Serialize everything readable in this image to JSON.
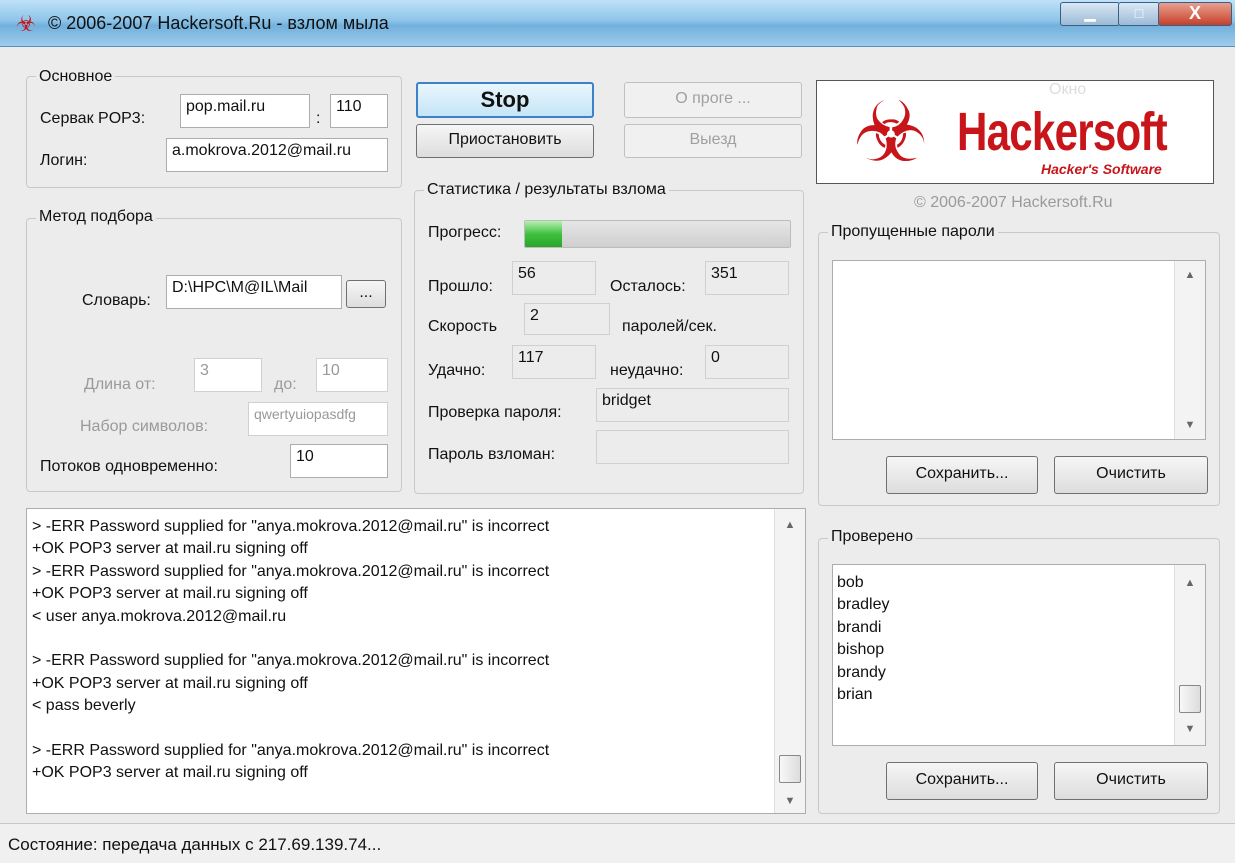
{
  "window": {
    "title": "© 2006-2007 Hackersoft.Ru - взлом мыла",
    "min_glyph": "▁",
    "max_glyph": "□",
    "close_glyph": "X"
  },
  "main_group": {
    "label": "Основное",
    "server_label": "Сервак POP3:",
    "server_value": "pop.mail.ru",
    "port_sep": ":",
    "port_value": "110",
    "login_label": "Логин:",
    "login_value": "a.mokrova.2012@mail.ru"
  },
  "method_group": {
    "label": "Метод подбора",
    "dict_label": "Словарь:",
    "dict_value": "D:\\HPC\\M@IL\\Mail",
    "browse_label": "...",
    "len_from_label": "Длина от:",
    "len_from_value": "3",
    "len_to_label": "до:",
    "len_to_value": "10",
    "charset_label": "Набор символов:",
    "charset_value": "qwertyuiopasdfg",
    "threads_label": "Потоков одновременно:",
    "threads_value": "10"
  },
  "actions": {
    "stop": "Stop",
    "pause": "Приостановить",
    "about": "О проге ...",
    "exit": "Выезд"
  },
  "stats": {
    "label": "Статистика / результаты взлома",
    "progress_label": "Прогресс:",
    "progress_fraction": 0.14,
    "elapsed_label": "Прошло:",
    "elapsed_value": "56",
    "remaining_label": "Осталось:",
    "remaining_value": "351",
    "speed_label": "Скорость",
    "speed_value": "2",
    "speed_unit": "паролей/сек.",
    "success_label": "Удачно:",
    "success_value": "117",
    "fail_label": "неудачно:",
    "fail_value": "0",
    "checking_label": "Проверка пароля:",
    "checking_value": "bridget",
    "cracked_label": "Пароль взломан:",
    "cracked_value": ""
  },
  "logo": {
    "text": "Hackersoft",
    "sub": "Hacker's Software",
    "caption": "© 2006-2007 Hackersoft.Ru",
    "hidden_label": "Окно"
  },
  "skipped": {
    "label": "Пропущенные пароли",
    "save": "Сохранить...",
    "clear": "Очистить"
  },
  "checked": {
    "label": "Проверено",
    "items": [
      "bob",
      "bradley",
      "brandi",
      "bishop",
      "brandy",
      "brian"
    ],
    "save": "Сохранить...",
    "clear": "Очистить"
  },
  "log": {
    "lines": [
      "> -ERR Password supplied for \"anya.mokrova.2012@mail.ru\" is incorrect",
      "+OK POP3 server at mail.ru signing off",
      "> -ERR Password supplied for \"anya.mokrova.2012@mail.ru\" is incorrect",
      "+OK POP3 server at mail.ru signing off",
      "< user anya.mokrova.2012@mail.ru",
      "",
      "> -ERR Password supplied for \"anya.mokrova.2012@mail.ru\" is incorrect",
      "+OK POP3 server at mail.ru signing off",
      "< pass beverly",
      "",
      "> -ERR Password supplied for \"anya.mokrova.2012@mail.ru\" is incorrect",
      "+OK POP3 server at mail.ru signing off"
    ]
  },
  "status": {
    "text": "Состояние: передача данных с 217.69.139.74..."
  },
  "scroll": {
    "up": "▲",
    "down": "▼"
  }
}
